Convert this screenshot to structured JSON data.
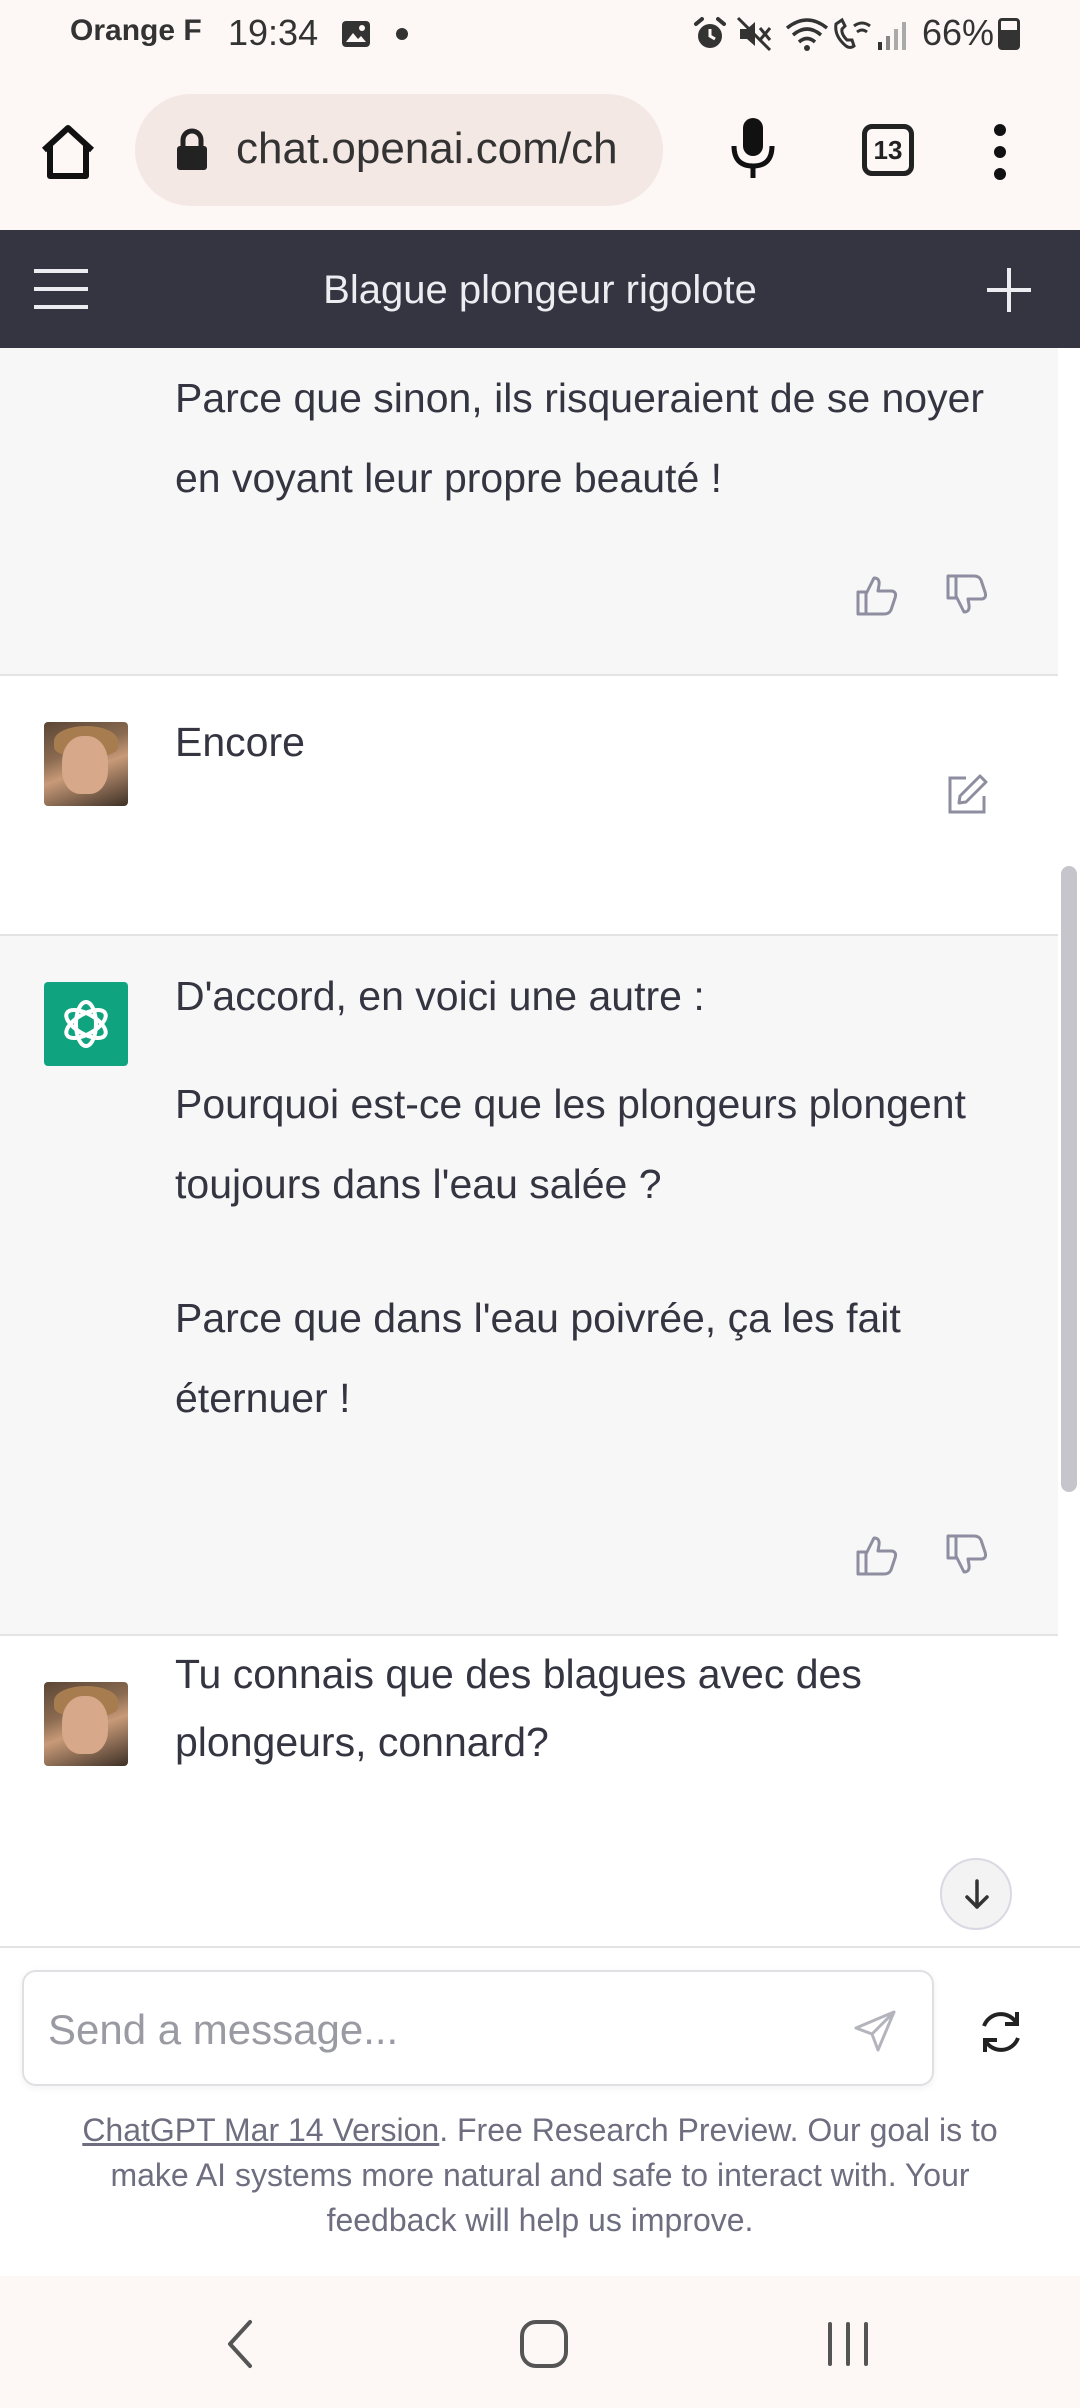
{
  "status_bar": {
    "carrier": "Orange F",
    "time": "19:34",
    "battery": "66%",
    "battery_level": 0.66,
    "icons": [
      "image-icon",
      "alarm-icon",
      "mute-icon",
      "wifi-icon",
      "wifi-calling-icon",
      "signal-icon"
    ]
  },
  "browser": {
    "url": "chat.openai.com/ch",
    "tab_count": "13",
    "icons": [
      "home-icon",
      "lock-icon",
      "mic-icon",
      "more-icon"
    ]
  },
  "header": {
    "title": "Blague plongeur rigolote",
    "icons": [
      "menu-icon",
      "new-chat-icon"
    ]
  },
  "messages": [
    {
      "role": "assistant",
      "paragraphs": [
        "Parce que sinon, ils risqueraient de se noyer en voyant leur propre beauté !"
      ]
    },
    {
      "role": "user",
      "paragraphs": [
        "Encore"
      ]
    },
    {
      "role": "assistant",
      "paragraphs": [
        "D'accord, en voici une autre :",
        "Pourquoi est-ce que les plongeurs plongent toujours dans l'eau salée ?",
        "Parce que dans l'eau poivrée, ça les fait éternuer !"
      ]
    },
    {
      "role": "user",
      "paragraphs": [
        "Tu connais que des blagues avec des plongeurs, connard?"
      ]
    }
  ],
  "input": {
    "placeholder": "Send a message...",
    "value": ""
  },
  "footer": {
    "link_text": "ChatGPT Mar 14 Version",
    "text": ". Free Research Preview. Our goal is to make AI systems more natural and safe to interact with. Your feedback will help us improve."
  },
  "nav": {
    "icons": [
      "back-icon",
      "home-nav-icon",
      "recents-icon"
    ]
  },
  "colors": {
    "header_bg": "#343541",
    "assistant_bg": "#f7f7f8",
    "chatgpt_green": "#10a37f",
    "chrome_bg": "#fdf7f6"
  }
}
